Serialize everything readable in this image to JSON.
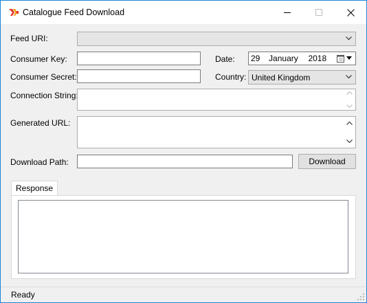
{
  "window": {
    "title": "Catalogue Feed Download"
  },
  "form": {
    "feed_uri_label": "Feed URI:",
    "feed_uri_value": "",
    "consumer_key_label": "Consumer Key:",
    "consumer_key_value": "",
    "consumer_secret_label": "Consumer Secret:",
    "consumer_secret_value": "",
    "date_label": "Date:",
    "date_day": "29",
    "date_month": "January",
    "date_year": "2018",
    "country_label": "Country:",
    "country_value": "United Kingdom",
    "connection_string_label": "Connection String:",
    "generated_url_label": "Generated URL:",
    "download_path_label": "Download Path:",
    "download_path_value": "",
    "download_button": "Download"
  },
  "tabs": [
    {
      "label": "Response"
    }
  ],
  "status": {
    "text": "Ready"
  },
  "icons": {
    "app": "app-logo-icon",
    "minimize": "minimize-icon",
    "maximize": "maximize-icon",
    "close": "close-icon",
    "dropdown": "chevron-down-icon",
    "calendar": "calendar-icon",
    "scroll_up": "scroll-up-icon",
    "scroll_down": "scroll-down-icon",
    "grip": "size-grip-icon"
  },
  "colors": {
    "window_border": "#1883d7",
    "accent_icon": "#e2372b"
  }
}
